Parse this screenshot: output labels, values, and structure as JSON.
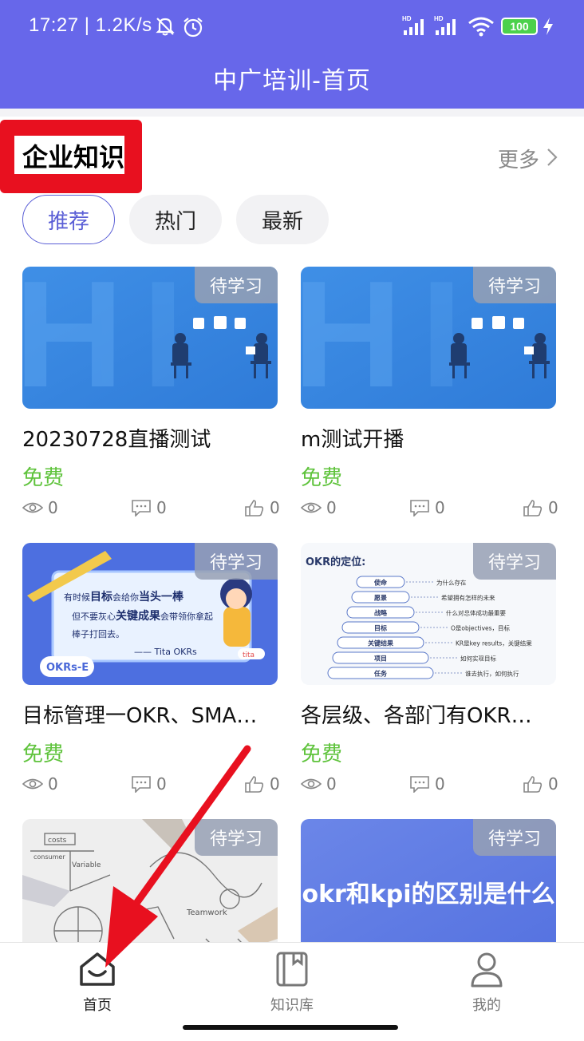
{
  "status_bar": {
    "time": "17:27 | 1.2K/s",
    "battery": "100",
    "signal_label": "HD"
  },
  "header": {
    "title": "中广培训-首页"
  },
  "section": {
    "title": "企业知识",
    "more": "更多"
  },
  "tabs": [
    {
      "label": "推荐",
      "active": true
    },
    {
      "label": "热门",
      "active": false
    },
    {
      "label": "最新",
      "active": false
    }
  ],
  "cards": [
    {
      "title": "20230728直播测试",
      "badge": "待学习",
      "price": "免费",
      "views": "0",
      "comments": "0",
      "likes": "0"
    },
    {
      "title": "m测试开播",
      "badge": "待学习",
      "price": "免费",
      "views": "0",
      "comments": "0",
      "likes": "0"
    },
    {
      "title": "目标管理一OKR、SMA…",
      "badge": "待学习",
      "price": "免费",
      "views": "0",
      "comments": "0",
      "likes": "0",
      "thumb_text": {
        "line1_a": "有时候",
        "line1_b": "目标",
        "line1_c": "会给你",
        "line1_d": "当头一棒",
        "line2_a": "但不要灰心",
        "line2_b": "关键成果",
        "line2_c": "会带领你拿起",
        "line3": "棒子打回去。",
        "sign": "—— Tita OKRs",
        "logo": "OKRs-E",
        "brand": "tita"
      }
    },
    {
      "title": "各层级、各部门有OKR…",
      "badge": "待学习",
      "price": "免费",
      "views": "0",
      "comments": "0",
      "likes": "0",
      "thumb_text": {
        "heading": "OKR的定位:",
        "rows": [
          {
            "k": "使命",
            "v": "为什么存在"
          },
          {
            "k": "愿景",
            "v": "希望拥有怎样的未来"
          },
          {
            "k": "战略",
            "v": "什么对总体成功最重要"
          },
          {
            "k": "目标",
            "v": "O是objectives，目标"
          },
          {
            "k": "关键结果",
            "v": "KR是key results，关键结果"
          },
          {
            "k": "项目",
            "v": "如何实现目标"
          },
          {
            "k": "任务",
            "v": "谁去执行，如何执行"
          }
        ]
      }
    },
    {
      "title": "",
      "badge": "待学习",
      "price": "",
      "views": "",
      "comments": "",
      "likes": "",
      "thumb_text": {
        "w1": "costs",
        "w2": "consumer",
        "w3": "Variable",
        "w4": "Teamwork"
      }
    },
    {
      "title": "",
      "badge": "待学习",
      "price": "",
      "views": "",
      "comments": "",
      "likes": "",
      "thumb_text": {
        "headline": "okr和kpi的区别是什么"
      }
    }
  ],
  "bottom_nav": [
    {
      "label": "首页",
      "icon": "home-icon",
      "active": true
    },
    {
      "label": "知识库",
      "icon": "book-icon",
      "active": false
    },
    {
      "label": "我的",
      "icon": "user-icon",
      "active": false
    }
  ],
  "colors": {
    "header": "#6767ea",
    "accent": "#5b5fd6",
    "free": "#5fc33c",
    "annotation": "#e8101f"
  }
}
